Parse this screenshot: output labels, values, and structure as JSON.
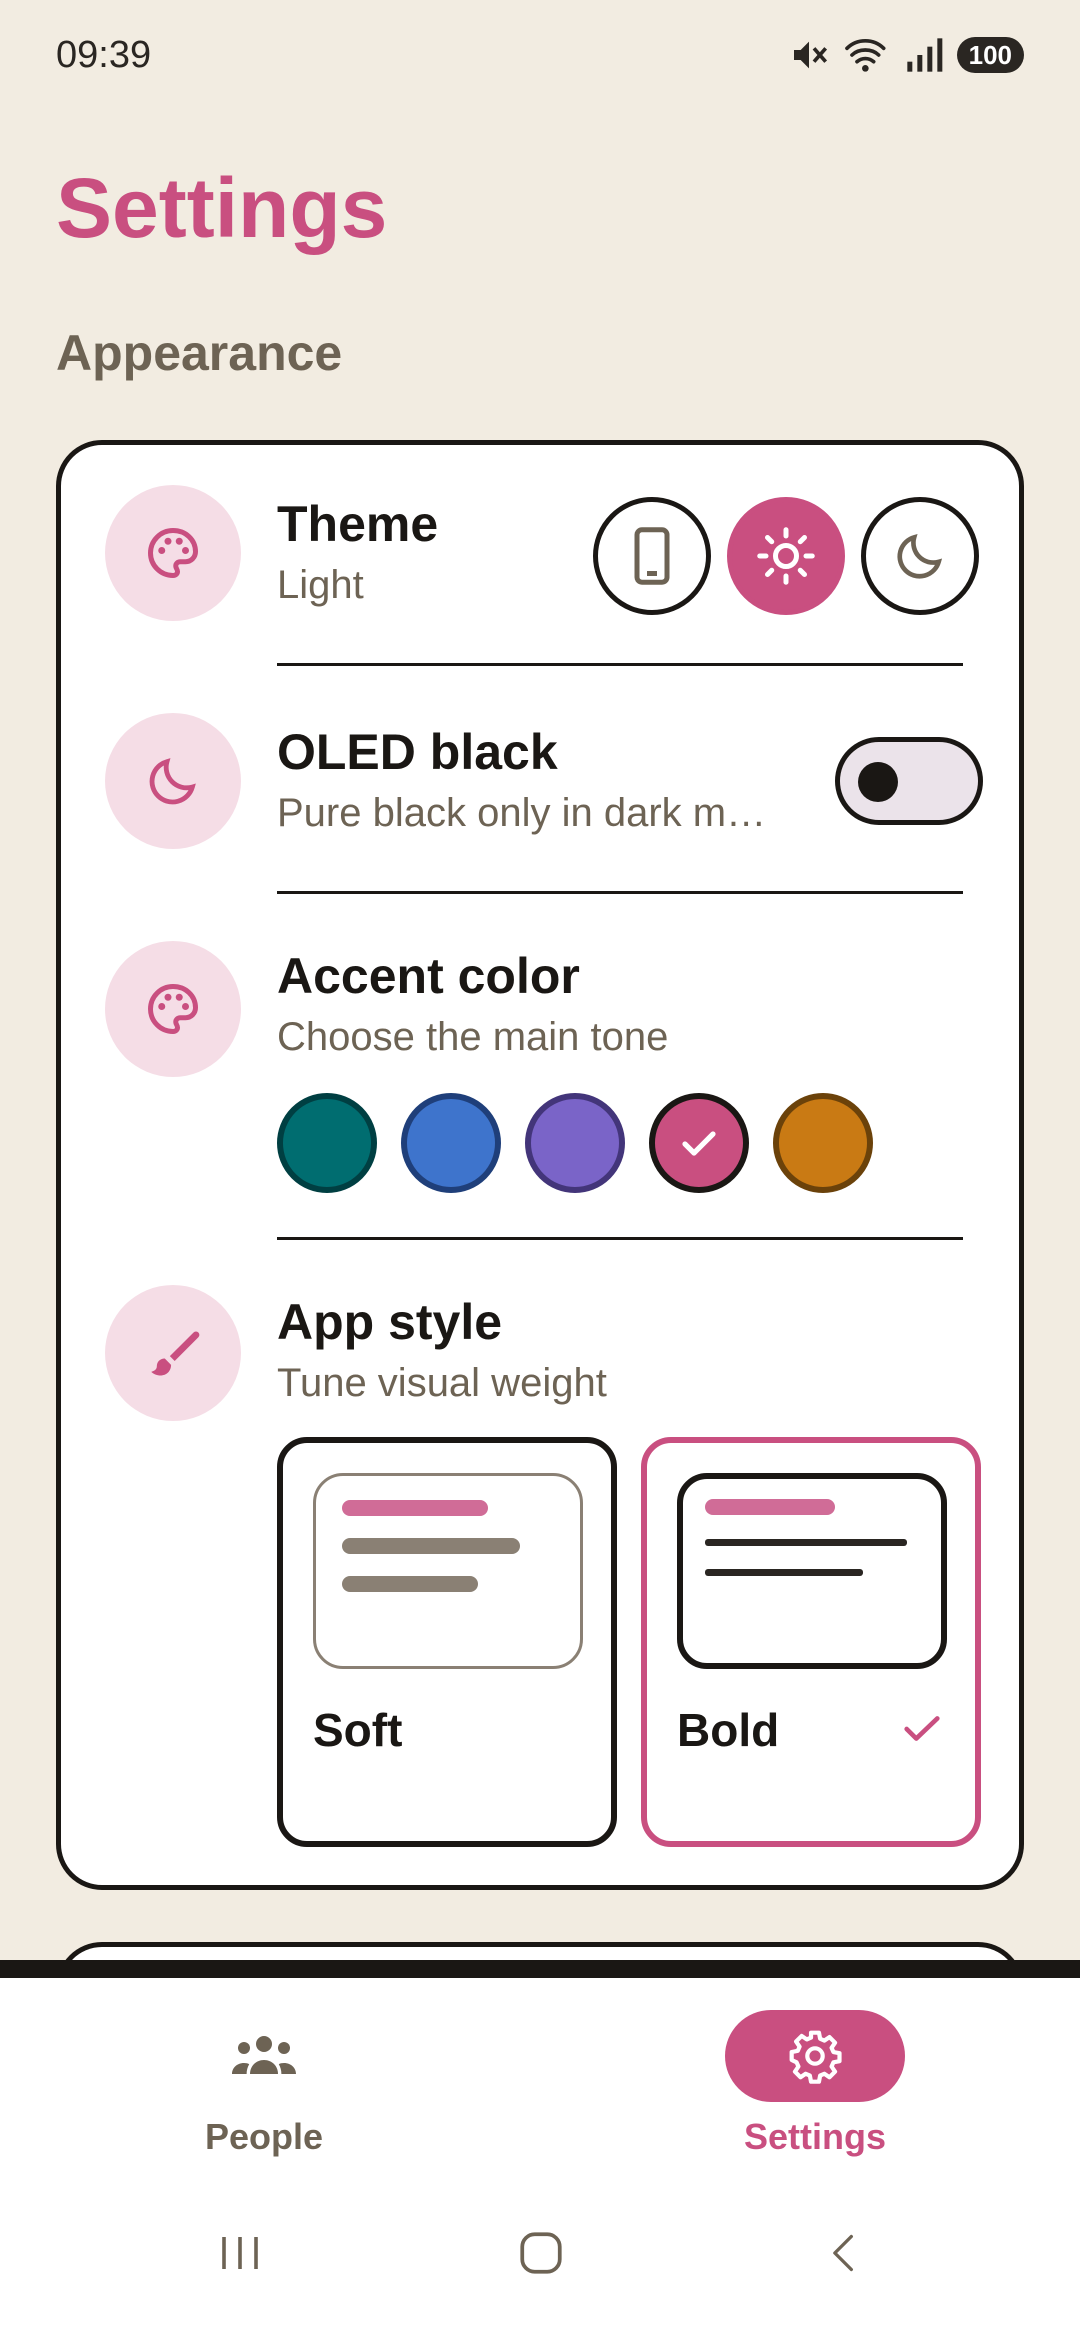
{
  "status_bar": {
    "time": "09:39",
    "battery": "100"
  },
  "page": {
    "title": "Settings",
    "section": "Appearance"
  },
  "theme_row": {
    "title": "Theme",
    "subtitle": "Light",
    "icon": "palette-icon",
    "options": [
      "system",
      "light",
      "dark"
    ],
    "selected": "light"
  },
  "oled_row": {
    "title": "OLED black",
    "subtitle": "Pure black only in dark m…",
    "icon": "moon-icon",
    "enabled": false
  },
  "accent_row": {
    "title": "Accent color",
    "subtitle": "Choose the main tone",
    "icon": "palette-icon",
    "swatches": [
      {
        "fill": "#006d70",
        "border": "#003f42"
      },
      {
        "fill": "#3e74cc",
        "border": "#1f3f7a"
      },
      {
        "fill": "#7a64c8",
        "border": "#43357a"
      },
      {
        "fill": "#c94f80",
        "border": "#1a1714",
        "selected": true
      },
      {
        "fill": "#c97a14",
        "border": "#6b420a"
      }
    ]
  },
  "style_row": {
    "title": "App style",
    "subtitle": "Tune visual weight",
    "icon": "brush-icon",
    "options": [
      {
        "label": "Soft"
      },
      {
        "label": "Bold",
        "selected": true
      }
    ]
  },
  "bottom_nav": {
    "people_label": "People",
    "settings_label": "Settings",
    "active": "Settings"
  },
  "colors": {
    "accent": "#c94f80",
    "background": "#f2ece1",
    "muted_text": "#6d6354",
    "icon_bg": "#f5dde6"
  }
}
